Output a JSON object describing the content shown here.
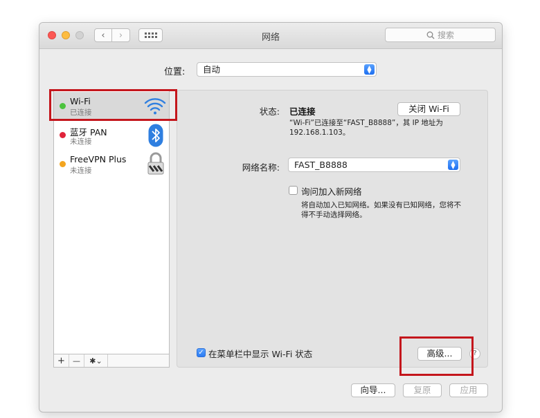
{
  "window": {
    "title": "网络",
    "search_placeholder": "搜索"
  },
  "location": {
    "label": "位置:",
    "value": "自动"
  },
  "services": [
    {
      "name": "Wi-Fi",
      "status": "已连接",
      "status_color": "#4cc33e",
      "icon": "wifi-icon"
    },
    {
      "name": "蓝牙 PAN",
      "status": "未连接",
      "status_color": "#e0243a",
      "icon": "bluetooth-icon"
    },
    {
      "name": "FreeVPN Plus",
      "status": "未连接",
      "status_color": "#f3a51f",
      "icon": "vpn-lock-icon"
    }
  ],
  "sidebar_toolbar": {
    "add": "+",
    "remove": "—",
    "action": "✱⌄"
  },
  "detail": {
    "status_label": "状态:",
    "status_value": "已连接",
    "turn_off_button": "关闭 Wi-Fi",
    "status_desc_line1": "“Wi-Fi”已连接至“FAST_B8888”，其 IP 地址为",
    "status_desc_line2": "192.168.1.103。",
    "network_name_label": "网络名称:",
    "network_name_value": "FAST_B8888",
    "ask_join_label": "询问加入新网络",
    "ask_join_desc_line1": "将自动加入已知网络。如果没有已知网络，您将不",
    "ask_join_desc_line2": "得不手动选择网络。",
    "show_menubar_label": "在菜单栏中显示 Wi-Fi 状态",
    "advanced_button": "高级...",
    "help_button": "?"
  },
  "footer": {
    "assistant_button": "向导...",
    "revert_button": "复原",
    "apply_button": "应用"
  },
  "colors": {
    "highlight": "#c4161c",
    "accent": "#2b7bf2"
  }
}
